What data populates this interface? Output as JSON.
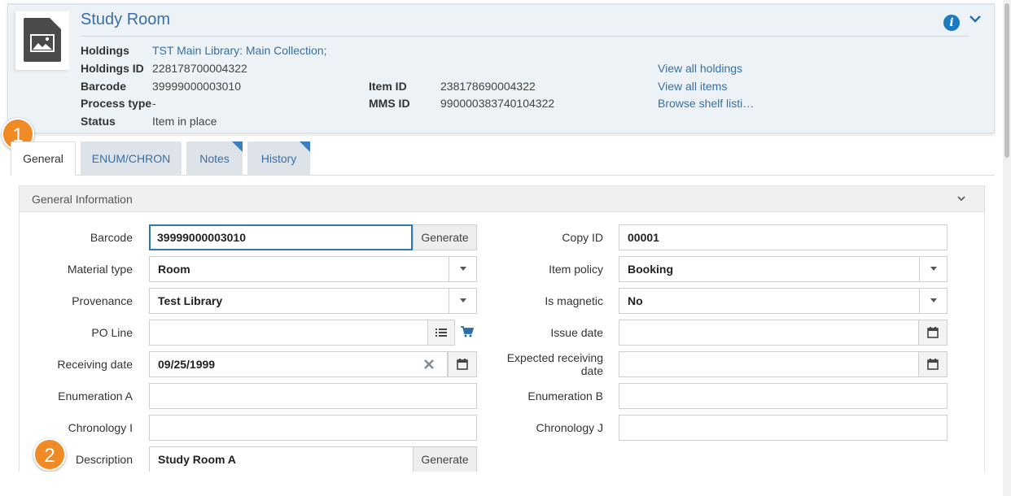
{
  "header": {
    "title": "Study Room",
    "holdings_label": "Holdings",
    "holdings_value": "TST Main Library: Main Collection;",
    "holdings_id_label": "Holdings ID",
    "holdings_id_value": "228178700004322",
    "barcode_label": "Barcode",
    "barcode_value": "39999000003010",
    "process_type_label": "Process type",
    "process_type_value": "-",
    "status_label": "Status",
    "status_value": "Item in place",
    "item_id_label": "Item ID",
    "item_id_value": "238178690004322",
    "mms_id_label": "MMS ID",
    "mms_id_value": "990000383740104322",
    "links": [
      "View all holdings",
      "View all items",
      "Browse shelf listi…"
    ]
  },
  "badges": {
    "step1": "1",
    "step2": "2"
  },
  "tabs": [
    {
      "label": "General",
      "active": true
    },
    {
      "label": "ENUM/CHRON",
      "active": false
    },
    {
      "label": "Notes",
      "active": false
    },
    {
      "label": "History",
      "active": false
    }
  ],
  "panel": {
    "title": "General Information",
    "left": {
      "barcode_label": "Barcode",
      "barcode_value": "39999000003010",
      "barcode_button": "Generate",
      "material_type_label": "Material type",
      "material_type_value": "Room",
      "provenance_label": "Provenance",
      "provenance_value": "Test Library",
      "po_line_label": "PO Line",
      "po_line_value": "",
      "receiving_date_label": "Receiving date",
      "receiving_date_value": "09/25/1999",
      "enum_a_label": "Enumeration A",
      "enum_a_value": "",
      "chron_i_label": "Chronology I",
      "chron_i_value": "",
      "description_label": "Description",
      "description_value": "Study Room A",
      "description_button": "Generate"
    },
    "right": {
      "copy_id_label": "Copy ID",
      "copy_id_value": "00001",
      "item_policy_label": "Item policy",
      "item_policy_value": "Booking",
      "is_magnetic_label": "Is magnetic",
      "is_magnetic_value": "No",
      "issue_date_label": "Issue date",
      "issue_date_value": "",
      "expected_receiving_label_1": "Expected receiving",
      "expected_receiving_label_2": "date",
      "expected_receiving_value": "",
      "enum_b_label": "Enumeration B",
      "enum_b_value": "",
      "chron_j_label": "Chronology J",
      "chron_j_value": ""
    }
  },
  "colors": {
    "accent": "#3a6fa0",
    "badge": "#f08a24",
    "focus": "#2f79b5",
    "info": "#1a7ac2"
  },
  "icons": [
    "image-icon",
    "info-icon",
    "chevron-down-icon",
    "list-icon",
    "cart-icon",
    "calendar-icon",
    "clear-icon"
  ]
}
